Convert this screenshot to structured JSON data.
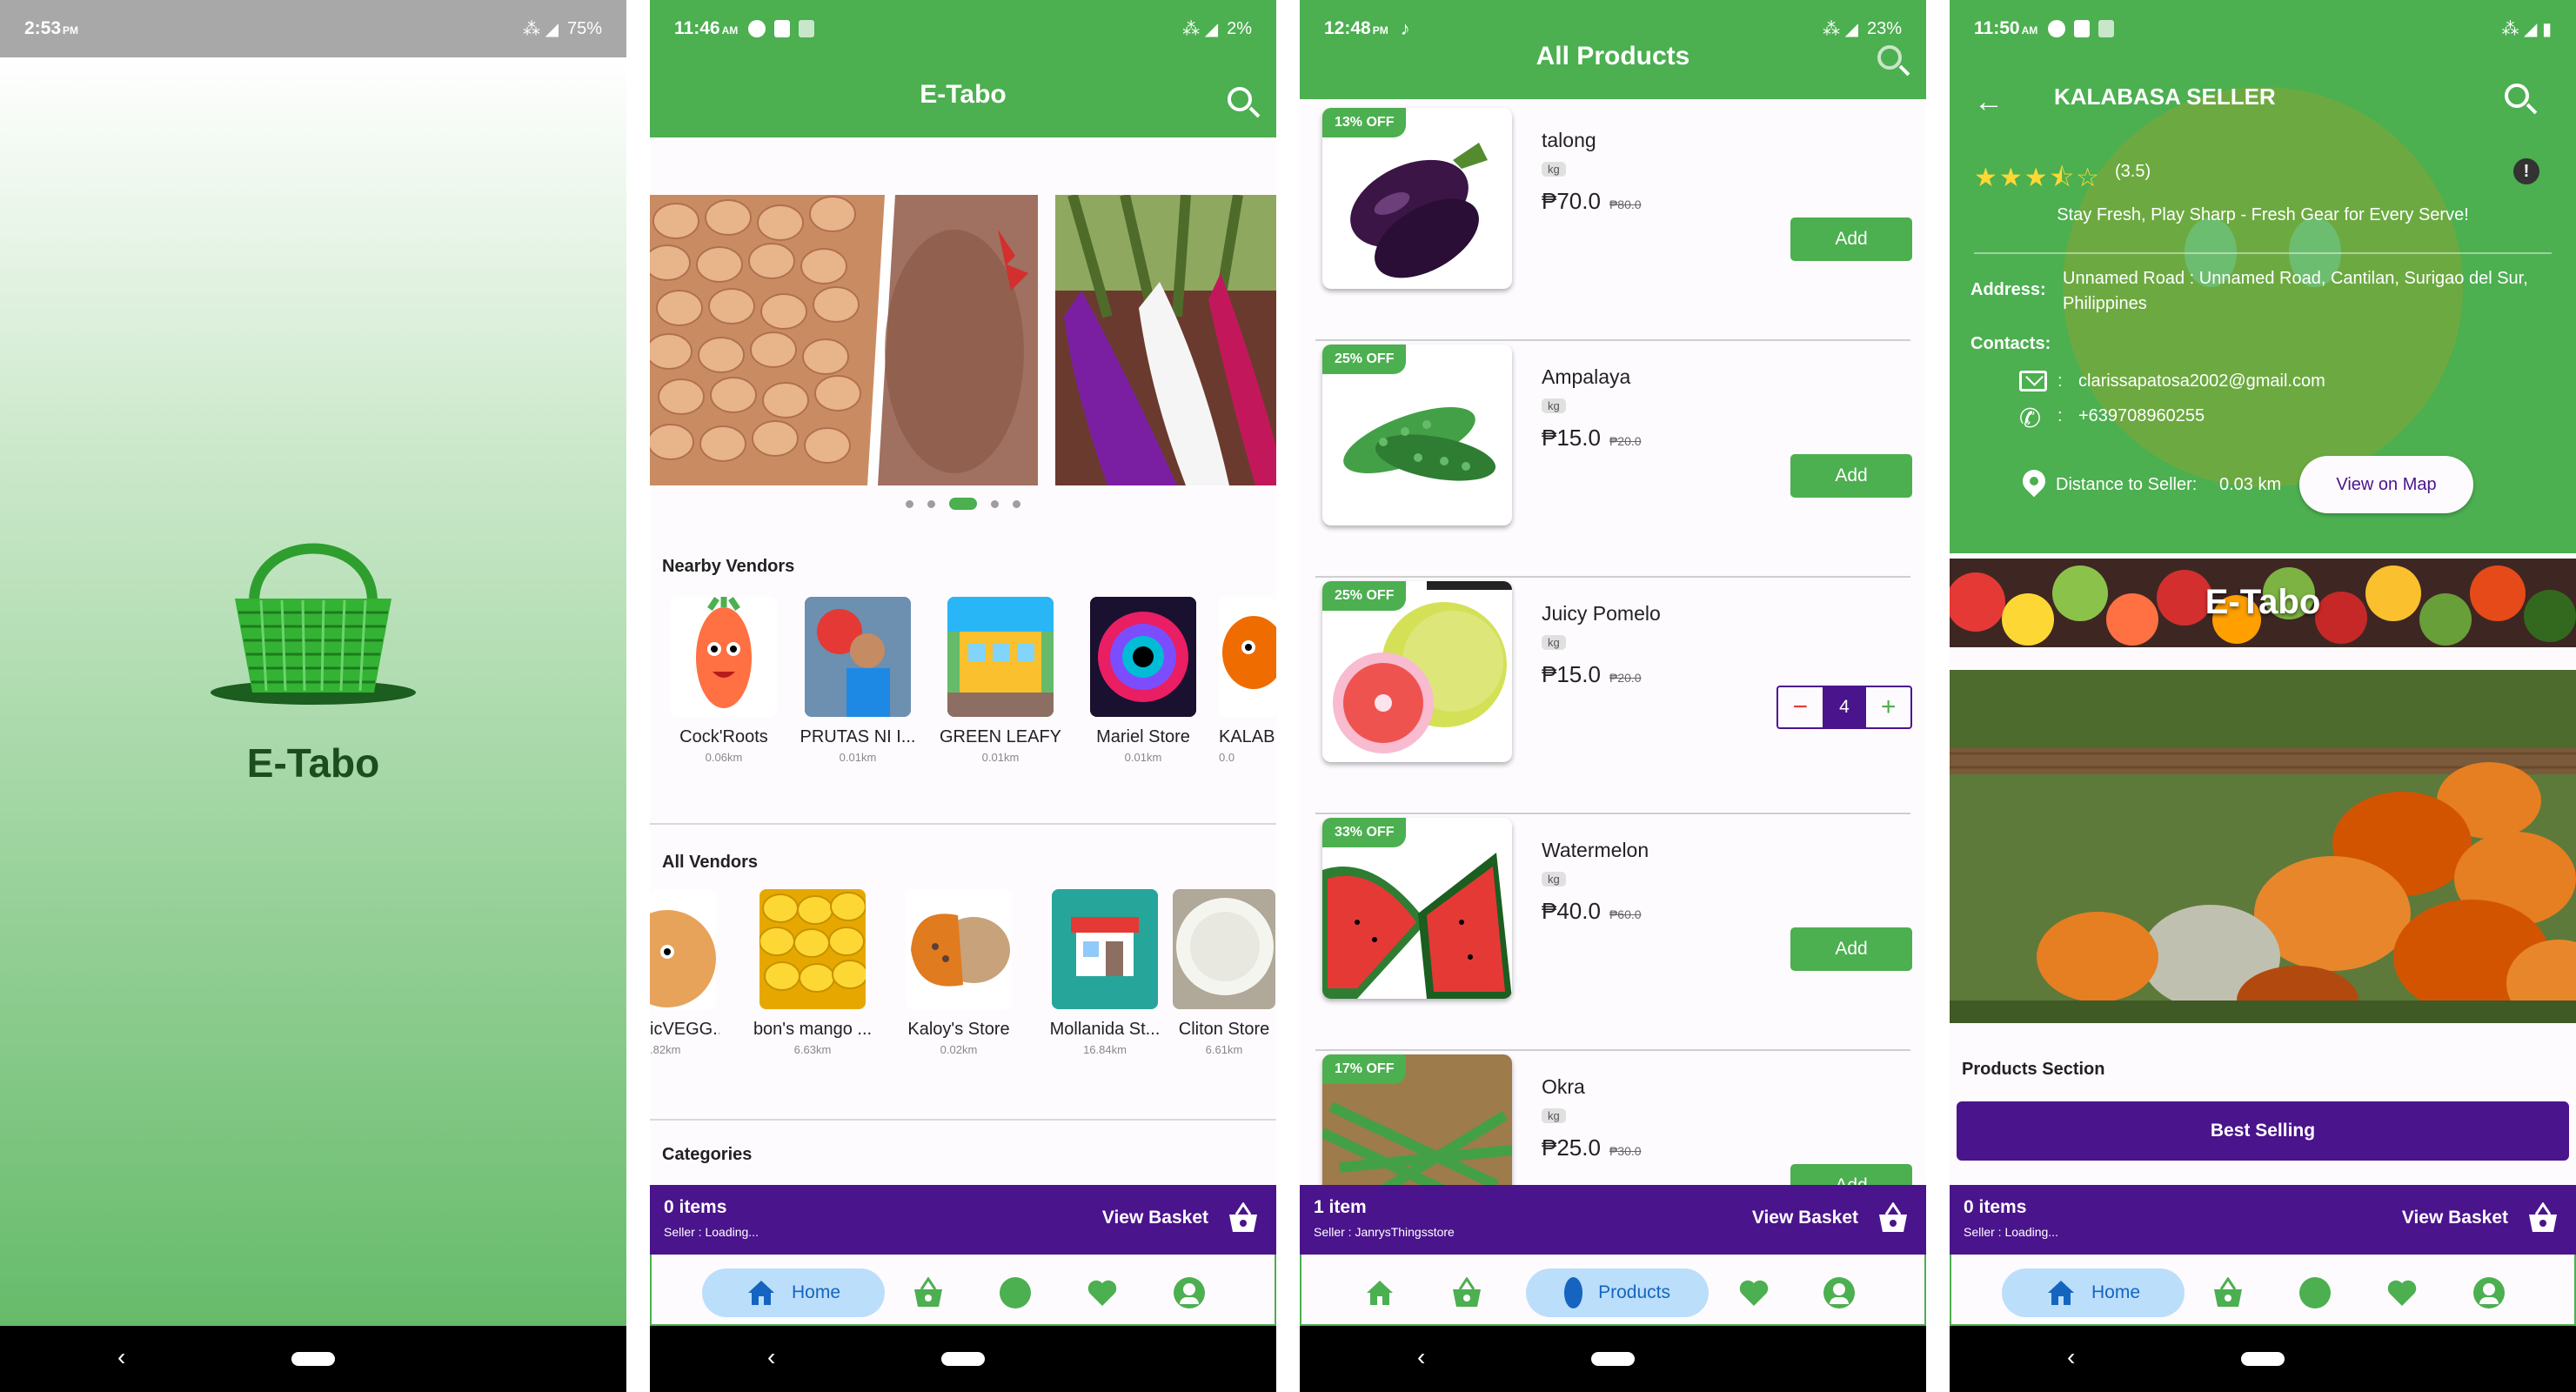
{
  "splash": {
    "status": {
      "time": "2:53",
      "ampm": "PM",
      "battery": "75%"
    },
    "app_name": "E-Tabo"
  },
  "home": {
    "status": {
      "time": "11:46",
      "ampm": "AM",
      "battery": "2%"
    },
    "title": "E-Tabo",
    "carousel_dots": 5,
    "carousel_active": 3,
    "nearby_title": "Nearby Vendors",
    "nearby_vendors": [
      {
        "name": "Cock'Roots",
        "distance": "0.06km"
      },
      {
        "name": "PRUTAS NI I...",
        "distance": "0.01km"
      },
      {
        "name": "GREEN LEAFY",
        "distance": "0.01km"
      },
      {
        "name": "Mariel Store",
        "distance": "0.01km"
      },
      {
        "name": "KALAB",
        "distance": "0.0"
      }
    ],
    "all_title": "All Vendors",
    "all_vendors": [
      {
        "name": "icVEGG...",
        "distance": ".82km"
      },
      {
        "name": "bon's mango ...",
        "distance": "6.63km"
      },
      {
        "name": "Kaloy's Store",
        "distance": "0.02km"
      },
      {
        "name": "Mollanida St...",
        "distance": "16.84km"
      },
      {
        "name": "Cliton Store",
        "distance": "6.61km"
      }
    ],
    "categories_title": "Categories",
    "basket": {
      "count": "0 items",
      "seller": "Seller : Loading...",
      "view": "View Basket"
    },
    "nav": {
      "home_label": "Home"
    }
  },
  "products": {
    "status": {
      "time": "12:48",
      "ampm": "PM",
      "battery": "23%"
    },
    "title": "All Products",
    "add_label": "Add",
    "items": [
      {
        "name": "talong",
        "unit": "kg",
        "price": "₱70.0",
        "old_price": "₱80.0",
        "discount": "13% OFF"
      },
      {
        "name": "Ampalaya",
        "unit": "kg",
        "price": "₱15.0",
        "old_price": "₱20.0",
        "discount": "25% OFF"
      },
      {
        "name": "Juicy Pomelo",
        "unit": "kg",
        "price": "₱15.0",
        "old_price": "₱20.0",
        "discount": "25% OFF",
        "qty": "4"
      },
      {
        "name": "Watermelon",
        "unit": "kg",
        "price": "₱40.0",
        "old_price": "₱60.0",
        "discount": "33% OFF"
      },
      {
        "name": "Okra",
        "unit": "kg",
        "price": "₱25.0",
        "old_price": "₱30.0",
        "discount": "17% OFF"
      }
    ],
    "basket": {
      "count": "1 item",
      "seller": "Seller : JanrysThingsstore",
      "view": "View Basket"
    },
    "nav": {
      "products_label": "Products"
    }
  },
  "seller": {
    "status": {
      "time": "11:50",
      "ampm": "AM"
    },
    "title": "KALABASA SELLER",
    "rating_value": 3.5,
    "rating_text": "(3.5)",
    "tagline": "Stay Fresh, Play Sharp - Fresh Gear for Every Serve!",
    "address_label": "Address:",
    "address": "Unnamed Road : Unnamed Road, Cantilan, Surigao del Sur, Philippines",
    "contacts_label": "Contacts:",
    "email": "clarissapatosa2002@gmail.com",
    "phone": "+639708960255",
    "colon": ":",
    "distance_label": "Distance to Seller:",
    "distance": "0.03 km",
    "map_button": "View on Map",
    "banner_title": "E-Tabo",
    "products_section": "Products Section",
    "best_selling": "Best Selling",
    "basket": {
      "count": "0 items",
      "seller": "Seller : Loading...",
      "view": "View Basket"
    },
    "nav": {
      "home_label": "Home"
    }
  },
  "colors": {
    "primary_green": "#4caf50",
    "purple": "#4a148c",
    "nav_pill": "#bbdefb"
  }
}
